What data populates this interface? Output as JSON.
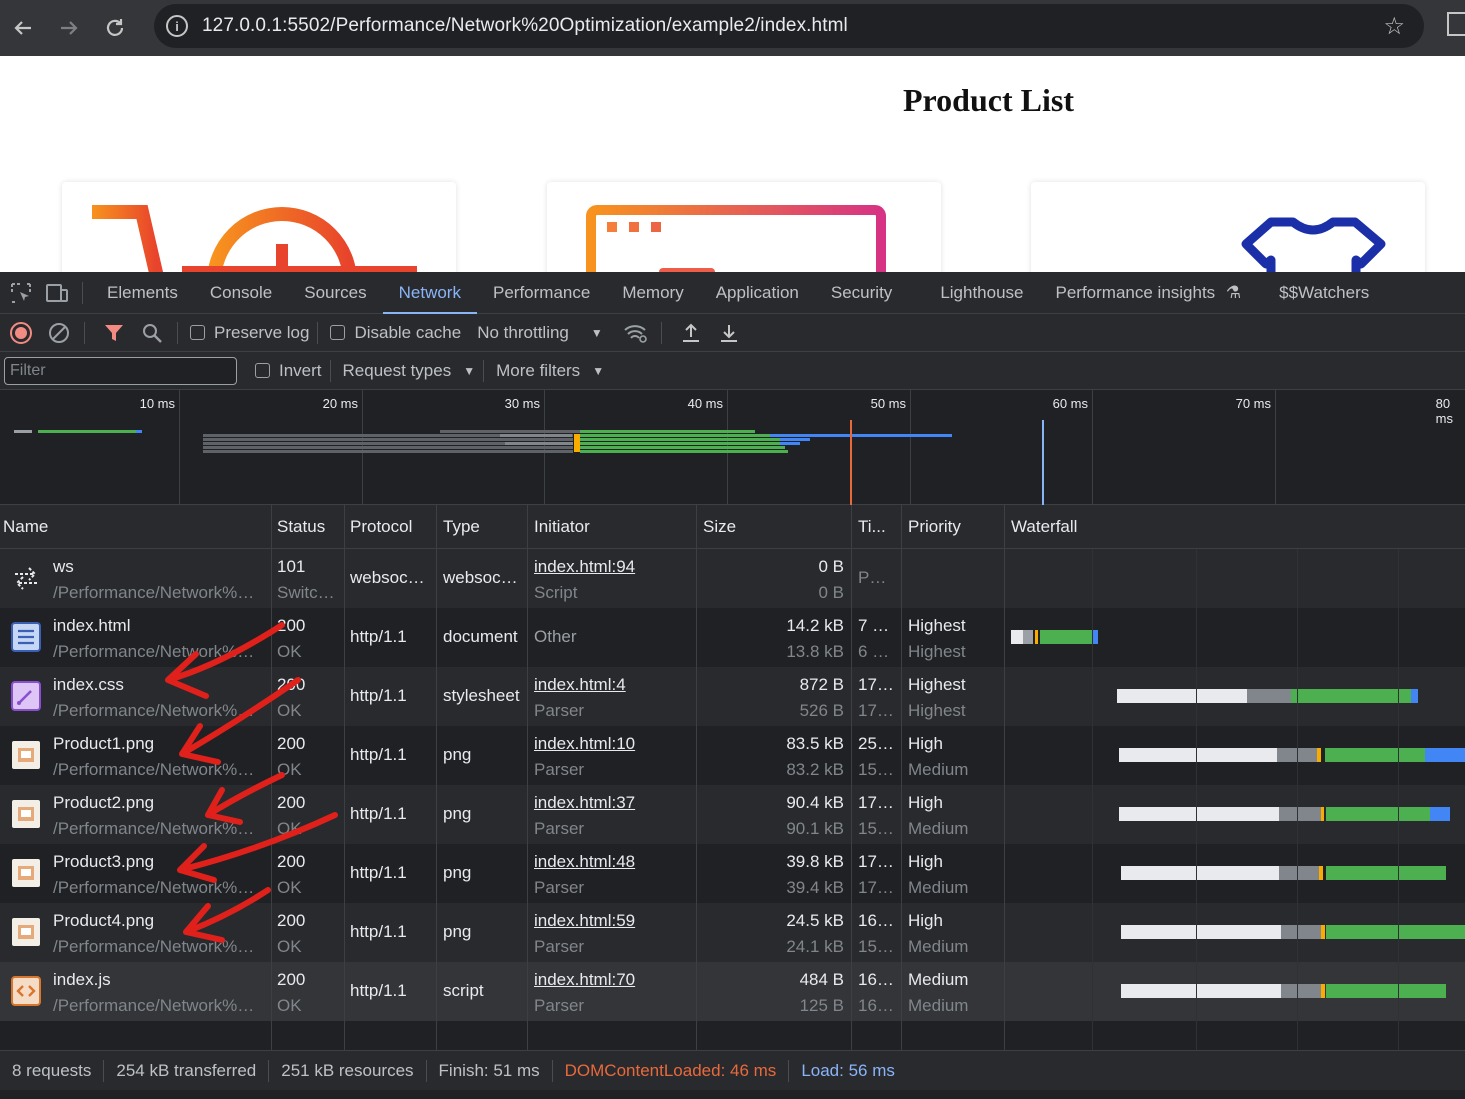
{
  "browser": {
    "url": "127.0.0.1:5502/Performance/Network%20Optimization/example2/index.html",
    "back_icon": "arrow-left-icon",
    "forward_icon": "arrow-right-icon",
    "reload_icon": "reload-icon"
  },
  "page": {
    "title": "Product List"
  },
  "devtools": {
    "tabs": [
      "Elements",
      "Console",
      "Sources",
      "Network",
      "Performance",
      "Memory",
      "Application",
      "Security",
      "Lighthouse",
      "Performance insights",
      "$$Watchers"
    ],
    "active_tab": "Network",
    "toolbar": {
      "preserve_log": "Preserve log",
      "disable_cache": "Disable cache",
      "throttling": "No throttling"
    },
    "filterbar": {
      "filter_placeholder": "Filter",
      "invert": "Invert",
      "request_types": "Request types",
      "more_filters": "More filters"
    },
    "overview": {
      "ticks": [
        "10 ms",
        "20 ms",
        "30 ms",
        "40 ms",
        "50 ms",
        "60 ms",
        "70 ms",
        "80 ms"
      ]
    },
    "columns": [
      "Name",
      "Status",
      "Protocol",
      "Type",
      "Initiator",
      "Size",
      "Ti...",
      "Priority",
      "Waterfall"
    ],
    "rows": [
      {
        "name": "ws",
        "path": "/Performance/Network%…",
        "status": "101",
        "status_text": "Switc…",
        "protocol": "websoc…",
        "type": "websoc…",
        "initiator": "index.html:94",
        "initiator_type": "Script",
        "size": "0 B",
        "resource_size": "0 B",
        "time": "P…",
        "time2": "",
        "priority": "",
        "priority2": "",
        "icon": "websocket-icon"
      },
      {
        "name": "index.html",
        "path": "/Performance/Network%…",
        "status": "200",
        "status_text": "OK",
        "protocol": "http/1.1",
        "type": "document",
        "initiator": "Other",
        "initiator_type": "",
        "size": "14.2 kB",
        "resource_size": "13.8 kB",
        "time": "7 …",
        "time2": "6 …",
        "priority": "Highest",
        "priority2": "Highest",
        "icon": "document-icon"
      },
      {
        "name": "index.css",
        "path": "/Performance/Network%…",
        "status": "200",
        "status_text": "OK",
        "protocol": "http/1.1",
        "type": "stylesheet",
        "initiator": "index.html:4",
        "initiator_type": "Parser",
        "size": "872 B",
        "resource_size": "526 B",
        "time": "17…",
        "time2": "17…",
        "priority": "Highest",
        "priority2": "Highest",
        "icon": "stylesheet-icon"
      },
      {
        "name": "Product1.png",
        "path": "/Performance/Network%…",
        "status": "200",
        "status_text": "OK",
        "protocol": "http/1.1",
        "type": "png",
        "initiator": "index.html:10",
        "initiator_type": "Parser",
        "size": "83.5 kB",
        "resource_size": "83.2 kB",
        "time": "25…",
        "time2": "15…",
        "priority": "High",
        "priority2": "Medium",
        "icon": "image-icon"
      },
      {
        "name": "Product2.png",
        "path": "/Performance/Network%…",
        "status": "200",
        "status_text": "OK",
        "protocol": "http/1.1",
        "type": "png",
        "initiator": "index.html:37",
        "initiator_type": "Parser",
        "size": "90.4 kB",
        "resource_size": "90.1 kB",
        "time": "17…",
        "time2": "15…",
        "priority": "High",
        "priority2": "Medium",
        "icon": "image-icon"
      },
      {
        "name": "Product3.png",
        "path": "/Performance/Network%…",
        "status": "200",
        "status_text": "OK",
        "protocol": "http/1.1",
        "type": "png",
        "initiator": "index.html:48",
        "initiator_type": "Parser",
        "size": "39.8 kB",
        "resource_size": "39.4 kB",
        "time": "17…",
        "time2": "17…",
        "priority": "High",
        "priority2": "Medium",
        "icon": "image-icon"
      },
      {
        "name": "Product4.png",
        "path": "/Performance/Network%…",
        "status": "200",
        "status_text": "OK",
        "protocol": "http/1.1",
        "type": "png",
        "initiator": "index.html:59",
        "initiator_type": "Parser",
        "size": "24.5 kB",
        "resource_size": "24.1 kB",
        "time": "16…",
        "time2": "15…",
        "priority": "High",
        "priority2": "Medium",
        "icon": "image-icon"
      },
      {
        "name": "index.js",
        "path": "/Performance/Network%…",
        "status": "200",
        "status_text": "OK",
        "protocol": "http/1.1",
        "type": "script",
        "initiator": "index.html:70",
        "initiator_type": "Parser",
        "size": "484 B",
        "resource_size": "125 B",
        "time": "16…",
        "time2": "16…",
        "priority": "Medium",
        "priority2": "Medium",
        "icon": "script-icon"
      }
    ],
    "summary": {
      "requests": "8 requests",
      "transferred": "254 kB transferred",
      "resources": "251 kB resources",
      "finish": "Finish: 51 ms",
      "dom_content_loaded": "DOMContentLoaded: 46 ms",
      "load": "Load: 56 ms"
    }
  },
  "colors": {
    "accent": "#8ab4f8",
    "dcl": "#e8693c",
    "waterfall_green": "#4caf50",
    "waterfall_blue": "#4285f4",
    "annotation": "#e0201a"
  }
}
